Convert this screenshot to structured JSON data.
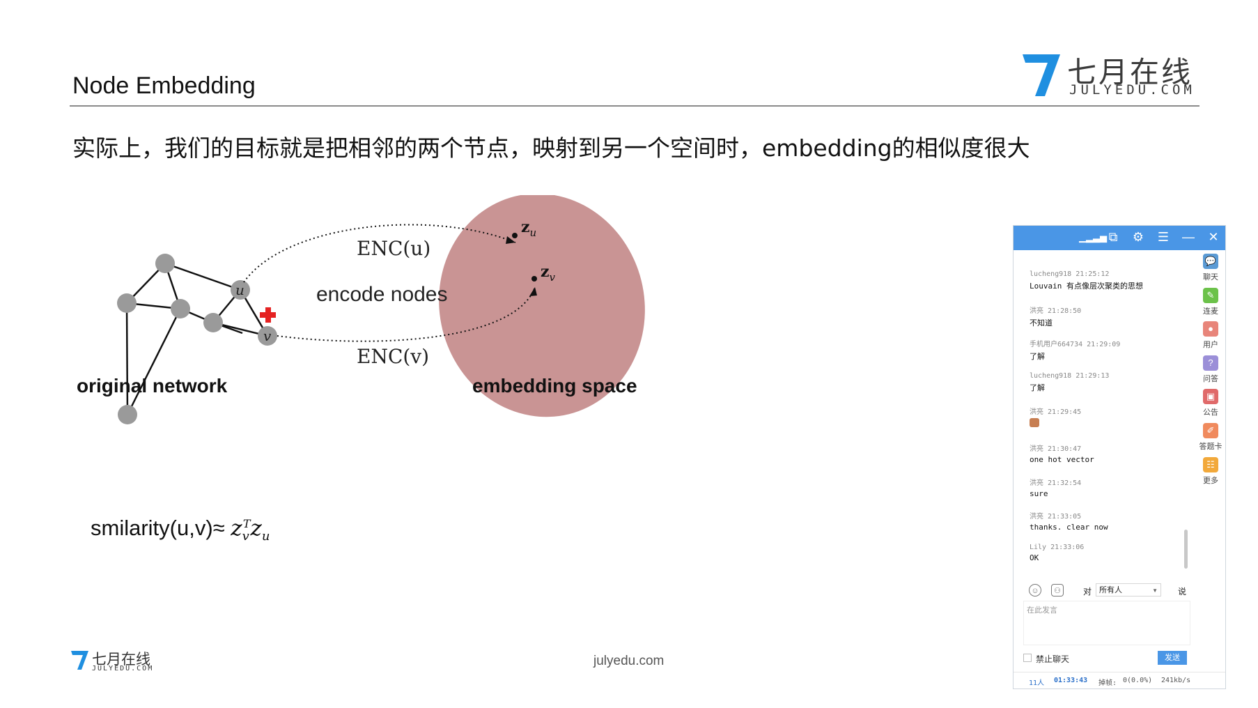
{
  "slide": {
    "title": "Node Embedding",
    "subtitle": "实际上，我们的目标就是把相邻的两个节点，映射到另一个空间时，embedding的相似度很大",
    "logo": {
      "cn": "七月在线",
      "en": "JULYEDU.COM",
      "color": "#1f8fe0"
    }
  },
  "diagram": {
    "enc_u": "ENC(u)",
    "enc_v": "ENC(v)",
    "encode_nodes": "encode nodes",
    "original_network": "original network",
    "embedding_space": "embedding space",
    "node_u": "u",
    "node_v": "v",
    "zu": "z",
    "zu_sub": "u",
    "zv": "z",
    "zv_sub": "v",
    "ellipse_color": "#c99494"
  },
  "formula": {
    "prefix": "smilarity(u,v)≈ ",
    "z1": "z",
    "z1_sub": "v",
    "z1_sup": "T",
    "z2": "z",
    "z2_sub": "u"
  },
  "footer": {
    "logo_cn": "七月在线",
    "logo_en": "JULYEDU.COM",
    "url": "julyedu.com"
  },
  "chat": {
    "accent": "#4a96e6",
    "messages": [
      {
        "user": "lucheng918",
        "time": "21:25:12",
        "text": "Louvain  有点像层次聚类的思想"
      },
      {
        "user": "洪亮",
        "time": "21:28:50",
        "text": "不知道"
      },
      {
        "user": "手机用户664734",
        "time": "21:29:09",
        "text": "了解"
      },
      {
        "user": "lucheng918",
        "time": "21:29:13",
        "text": "了解"
      },
      {
        "user": "洪亮",
        "time": "21:29:45",
        "text": ""
      },
      {
        "user": "洪亮",
        "time": "21:30:47",
        "text": "one  hot  vector"
      },
      {
        "user": "洪亮",
        "time": "21:32:54",
        "text": "sure"
      },
      {
        "user": "洪亮",
        "time": "21:33:05",
        "text": "thanks.  clear  now"
      },
      {
        "user": "Lily",
        "time": "21:33:06",
        "text": "OK"
      }
    ],
    "sidebar": [
      {
        "label": "聊天",
        "icon": "chat-icon",
        "color": "#5b9bd5"
      },
      {
        "label": "连麦",
        "icon": "mic-icon",
        "color": "#6cc24a"
      },
      {
        "label": "用户",
        "icon": "user-icon",
        "color": "#e8857a"
      },
      {
        "label": "问答",
        "icon": "question-icon",
        "color": "#9b8fd8"
      },
      {
        "label": "公告",
        "icon": "announcement-icon",
        "color": "#e06a6a"
      },
      {
        "label": "答题卡",
        "icon": "answer-card-icon",
        "color": "#f08a5d"
      },
      {
        "label": "更多",
        "icon": "more-icon",
        "color": "#f2a93b"
      }
    ],
    "to_label": "对",
    "to_value": "所有人",
    "say_label": "说",
    "input_placeholder": "在此发言",
    "ban_label": "禁止聊天",
    "send_label": "发送",
    "status": {
      "count": "11人",
      "time": "01:33:43",
      "frames_label": "掉帧:",
      "frames_value": "0(0.0%)",
      "bitrate": "241kb/s"
    }
  }
}
